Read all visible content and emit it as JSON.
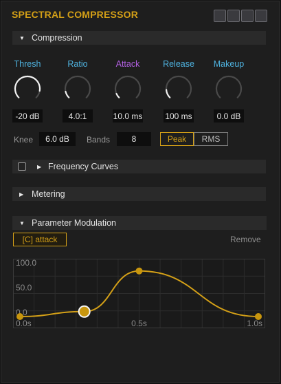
{
  "title": "SPECTRAL COMPRESSOR",
  "colors": {
    "accent": "#d4a017",
    "blue": "#4fb3e0",
    "purple": "#b15fe0",
    "panel": "#1e1e1e"
  },
  "window_buttons": [
    "window-button",
    "window-button",
    "window-button",
    "window-button"
  ],
  "sections": {
    "compression": "Compression",
    "frequency_curves": "Frequency Curves",
    "metering": "Metering",
    "parameter_modulation": "Parameter Modulation"
  },
  "knobs": [
    {
      "label": "Thresh",
      "value": "-20 dB",
      "color": "#4fb3e0",
      "fill": 0.87
    },
    {
      "label": "Ratio",
      "value": "4.0:1",
      "color": "#4fb3e0",
      "fill": 0.12
    },
    {
      "label": "Attack",
      "value": "10.0 ms",
      "color": "#b15fe0",
      "fill": 0.08
    },
    {
      "label": "Release",
      "value": "100 ms",
      "color": "#4fb3e0",
      "fill": 0.15
    },
    {
      "label": "Makeup",
      "value": "0.0 dB",
      "color": "#4fb3e0",
      "fill": 0.0
    }
  ],
  "knee": {
    "label": "Knee",
    "value": "6.0 dB"
  },
  "bands": {
    "label": "Bands",
    "value": "8"
  },
  "detector": {
    "peak": "Peak",
    "rms": "RMS",
    "selected": "Peak"
  },
  "modulation": {
    "target_button": "[C] attack",
    "remove": "Remove",
    "y_ticks": [
      "100.0",
      "50.0",
      "0.0"
    ],
    "x_ticks": [
      "0.0s",
      "0.5s",
      "1.0s"
    ],
    "x_range": [
      0,
      1.0
    ],
    "y_range": [
      0,
      100
    ],
    "points": [
      {
        "x": 0.0,
        "y": 0
      },
      {
        "x": 0.27,
        "y": 10
      },
      {
        "x": 0.5,
        "y": 92
      },
      {
        "x": 1.0,
        "y": 0
      }
    ],
    "selected_point": 1
  }
}
